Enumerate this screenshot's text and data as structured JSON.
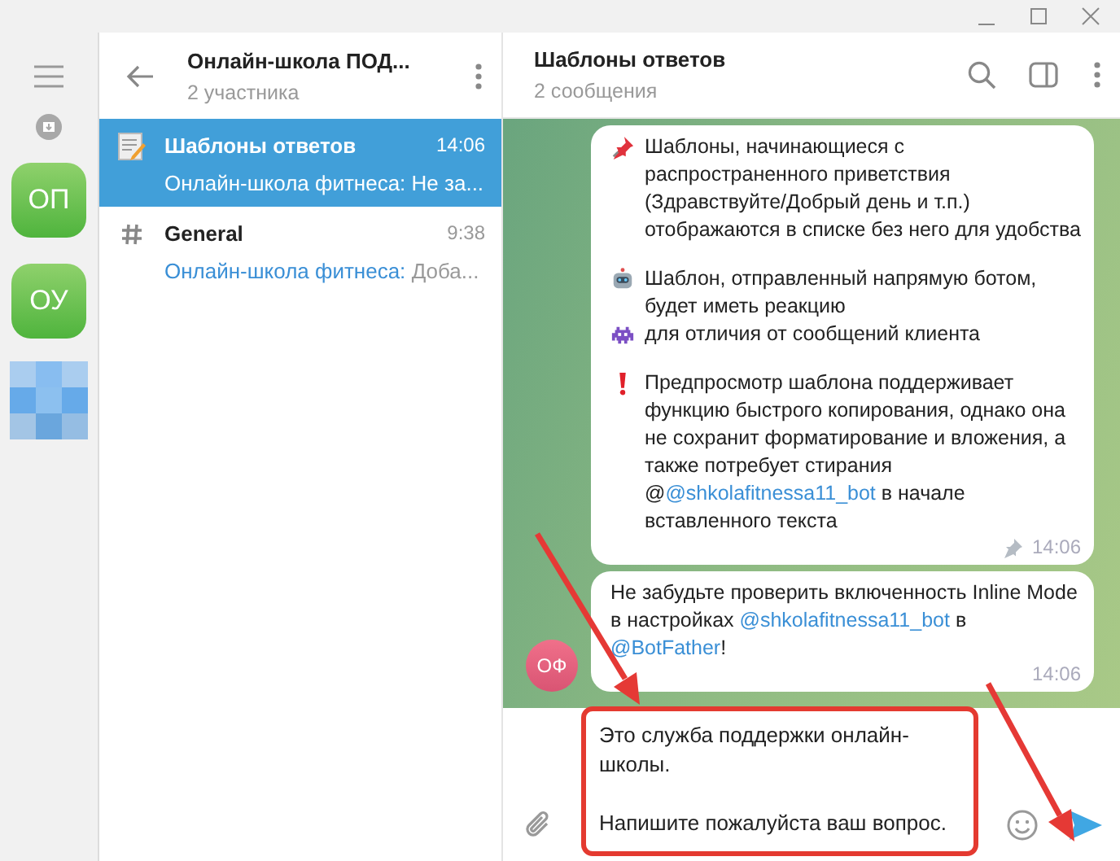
{
  "rail": {
    "folders": [
      {
        "label": "ОП"
      },
      {
        "label": "ОУ"
      }
    ]
  },
  "chat_list": {
    "title": "Онлайн-школа ПОД...",
    "subtitle": "2 участника",
    "items": [
      {
        "kind": "note",
        "title": "Шаблоны ответов",
        "time": "14:06",
        "preview": "Онлайн-школа фитнеса: Не за...",
        "selected": true
      },
      {
        "kind": "topic",
        "title": "General",
        "time": "9:38",
        "sender": "Онлайн-школа фитнеса:",
        "preview": "Доба...",
        "selected": false
      }
    ]
  },
  "chat": {
    "title": "Шаблоны ответов",
    "subtitle": "2 сообщения",
    "messages": [
      {
        "pinned": true,
        "time": "14:06",
        "paragraphs": [
          [
            {
              "kind": "pin"
            },
            {
              "kind": "text",
              "text": "Шаблоны, начинающиеся с распространенного приветствия (Здравствуйте/Добрый день и т.п.) отображаются в списке без него для удобства"
            }
          ],
          [
            {
              "kind": "robot"
            },
            {
              "kind": "text",
              "text": "Шаблон, отправленный напрямую ботом, будет иметь реакцию"
            },
            {
              "kind": "invader"
            },
            {
              "kind": "text",
              "text": "для отличия от сообщений клиента"
            }
          ],
          [
            {
              "kind": "exclamation"
            },
            {
              "kind": "text",
              "text": "Предпросмотр шаблона поддерживает функцию быстрого копирования, однако она не сохранит форматирование и вложения, а также потребует стирания @"
            },
            {
              "kind": "link",
              "text": "@shkolafitnessa11_bot"
            },
            {
              "kind": "text",
              "text": " в начале вставленного текста"
            }
          ]
        ]
      },
      {
        "pinned": false,
        "time": "14:06",
        "avatar": "ОФ",
        "paragraphs": [
          [
            {
              "kind": "text",
              "text": "Не забудьте проверить включенность Inline Mode в настройках "
            },
            {
              "kind": "link",
              "text": "@shkolafitnessa11_bot"
            },
            {
              "kind": "text",
              "text": " в "
            },
            {
              "kind": "link",
              "text": "@BotFather"
            },
            {
              "kind": "text",
              "text": "!"
            }
          ]
        ]
      }
    ]
  },
  "composer": {
    "value": "Это служба поддержки онлайн-школы.\n\nНапишите пожалуйста ваш вопрос."
  }
}
